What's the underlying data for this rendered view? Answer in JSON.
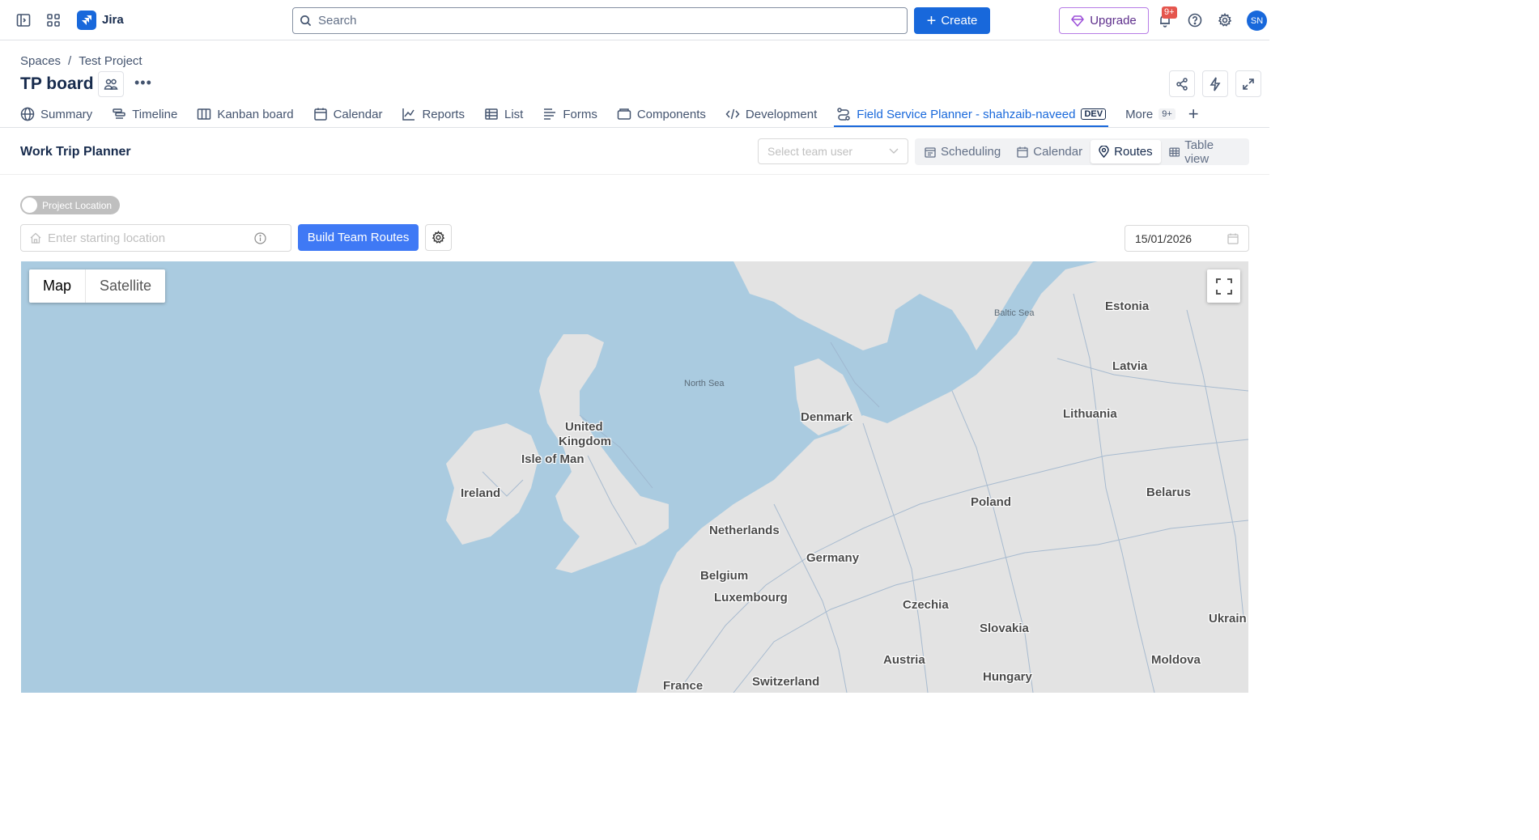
{
  "topnav": {
    "app_name": "Jira",
    "search_placeholder": "Search",
    "create_label": "Create",
    "upgrade_label": "Upgrade",
    "notification_count": "9+",
    "avatar_initials": "SN"
  },
  "header": {
    "breadcrumb": [
      "Spaces",
      "Test Project"
    ],
    "board_title": "TP board"
  },
  "tabs": [
    {
      "label": "Summary",
      "icon": "globe-icon"
    },
    {
      "label": "Timeline",
      "icon": "timeline-icon"
    },
    {
      "label": "Kanban board",
      "icon": "board-icon"
    },
    {
      "label": "Calendar",
      "icon": "calendar-icon"
    },
    {
      "label": "Reports",
      "icon": "chart-icon"
    },
    {
      "label": "List",
      "icon": "list-icon"
    },
    {
      "label": "Forms",
      "icon": "form-icon"
    },
    {
      "label": "Components",
      "icon": "component-icon"
    },
    {
      "label": "Development",
      "icon": "code-icon"
    },
    {
      "label": "Field Service Planner - shahzaib-naveed",
      "icon": "route-icon",
      "tag": "DEV",
      "active": true
    },
    {
      "label": "More",
      "count": "9+"
    }
  ],
  "app": {
    "title": "Work Trip Planner",
    "team_user_placeholder": "Select team user",
    "views": [
      {
        "label": "Scheduling",
        "icon": "schedule-icon"
      },
      {
        "label": "Calendar",
        "icon": "calendar-icon"
      },
      {
        "label": "Routes",
        "icon": "pin-icon",
        "active": true
      },
      {
        "label": "Table view",
        "icon": "table-icon"
      }
    ],
    "project_location_toggle": "Project Location",
    "starting_location_placeholder": "Enter starting location",
    "build_routes_label": "Build Team Routes",
    "date_value": "15/01/2026"
  },
  "map": {
    "types": [
      "Map",
      "Satellite"
    ],
    "active_type": "Map",
    "labels": [
      "Estonia",
      "Latvia",
      "Lithuania",
      "Belarus",
      "Poland",
      "Denmark",
      "United",
      "Kingdom",
      "Isle of Man",
      "Ireland",
      "Netherlands",
      "Germany",
      "Belgium",
      "Luxembourg",
      "Czechia",
      "Slovakia",
      "Ukrain",
      "Austria",
      "Moldova",
      "Hungary",
      "Switzerland",
      "France"
    ],
    "sea_labels": [
      "Baltic Sea",
      "North Sea"
    ]
  },
  "colors": {
    "accent": "#1868db",
    "button": "#3f79f5",
    "water": "#aacbe0",
    "land": "#e3e3e3"
  }
}
